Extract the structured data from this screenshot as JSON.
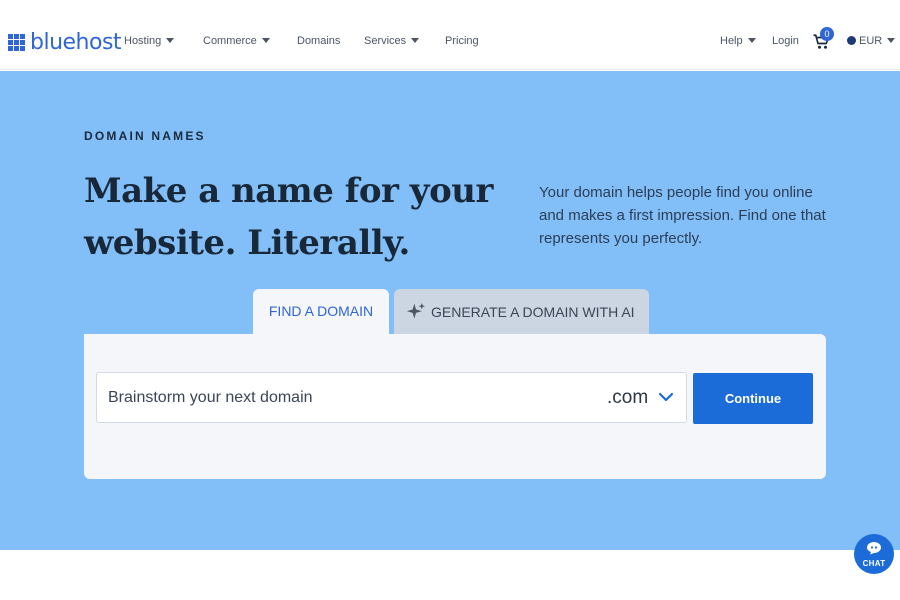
{
  "nav": {
    "logo_text": "bluehost",
    "items": [
      {
        "label": "Hosting",
        "dropdown": true
      },
      {
        "label": "Commerce",
        "dropdown": true
      },
      {
        "label": "Domains",
        "dropdown": false
      },
      {
        "label": "Services",
        "dropdown": true
      },
      {
        "label": "Pricing",
        "dropdown": false
      }
    ],
    "right": {
      "help": "Help",
      "login": "Login",
      "cart_count": "0",
      "currency": "EUR"
    },
    "icons": [
      "logo-grid-icon",
      "cart-icon",
      "currency-flag-icon",
      "chevron-down-icon"
    ]
  },
  "hero": {
    "eyebrow": "DOMAIN NAMES",
    "headline_line1": "Make a name for your",
    "headline_line2": "website. Literally.",
    "subtext": "Your domain helps people find you online and makes a first impression. Find one that represents you perfectly.",
    "tabs": {
      "find": "FIND A DOMAIN",
      "ai": "GENERATE A DOMAIN WITH AI"
    },
    "search": {
      "placeholder": "Brainstorm your next domain",
      "value": "",
      "tld": ".com"
    },
    "continue_label": "Continue"
  },
  "chat": {
    "label": "CHAT"
  },
  "colors": {
    "brand": "#2f66d6",
    "hero_bg": "#82bef8",
    "button": "#1b6cd9"
  }
}
